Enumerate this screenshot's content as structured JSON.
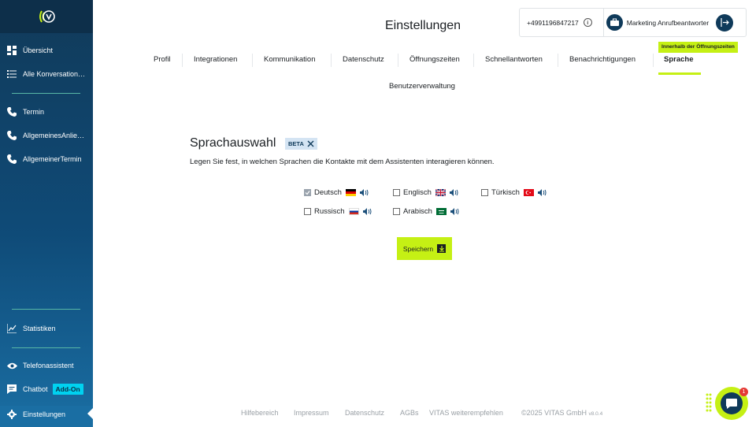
{
  "sidebar": {
    "items": [
      {
        "label": "Übersicht"
      },
      {
        "label": "Alle Konversationen"
      },
      {
        "label": "Termin"
      },
      {
        "label": "AllgemeinesAnliegen"
      },
      {
        "label": "AllgemeinerTermin"
      },
      {
        "label": "Statistiken"
      },
      {
        "label": "Telefonassistent"
      },
      {
        "label": "Chatbot",
        "badge": "Add-On"
      },
      {
        "label": "Einstellungen"
      }
    ]
  },
  "header": {
    "title": "Einstellungen",
    "phone": "+4991196847217",
    "assistant_name": "Marketing Anrufbeantworter",
    "hours_badge": "Innerhalb der Öffnungszeiten"
  },
  "tabs": [
    {
      "label": "Profil"
    },
    {
      "label": "Integrationen"
    },
    {
      "label": "Kommunikation"
    },
    {
      "label": "Datenschutz"
    },
    {
      "label": "Öffnungszeiten"
    },
    {
      "label": "Schnellantworten"
    },
    {
      "label": "Benachrichtigungen"
    },
    {
      "label": "Sprache",
      "active": true
    },
    {
      "label": "Benutzerverwaltung"
    }
  ],
  "language_section": {
    "title": "Sprachauswahl",
    "badge": "BETA",
    "description": "Legen Sie fest, in welchen Sprachen die Kontakte mit dem Assistenten interagieren können.",
    "languages": [
      {
        "label": "Deutsch",
        "checked": true,
        "flag": "germany-flag"
      },
      {
        "label": "Englisch",
        "checked": false,
        "flag": "uk-flag"
      },
      {
        "label": "Türkisch",
        "checked": false,
        "flag": "turkey-flag"
      },
      {
        "label": "Russisch",
        "checked": false,
        "flag": "russia-flag"
      },
      {
        "label": "Arabisch",
        "checked": false,
        "flag": "saudi-arabia-flag"
      }
    ],
    "save_label": "Speichern"
  },
  "footer": {
    "links": [
      "Hilfebereich",
      "Impressum",
      "Datenschutz",
      "AGBs",
      "VITAS weiterempfehlen"
    ],
    "copyright": "©2025 VITAS GmbH",
    "version": "v8.0.4"
  },
  "chat": {
    "badge_count": "1"
  },
  "colors": {
    "accent": "#c5f014",
    "sidebar": "#0f4b78",
    "dark": "#0f3a5a"
  }
}
